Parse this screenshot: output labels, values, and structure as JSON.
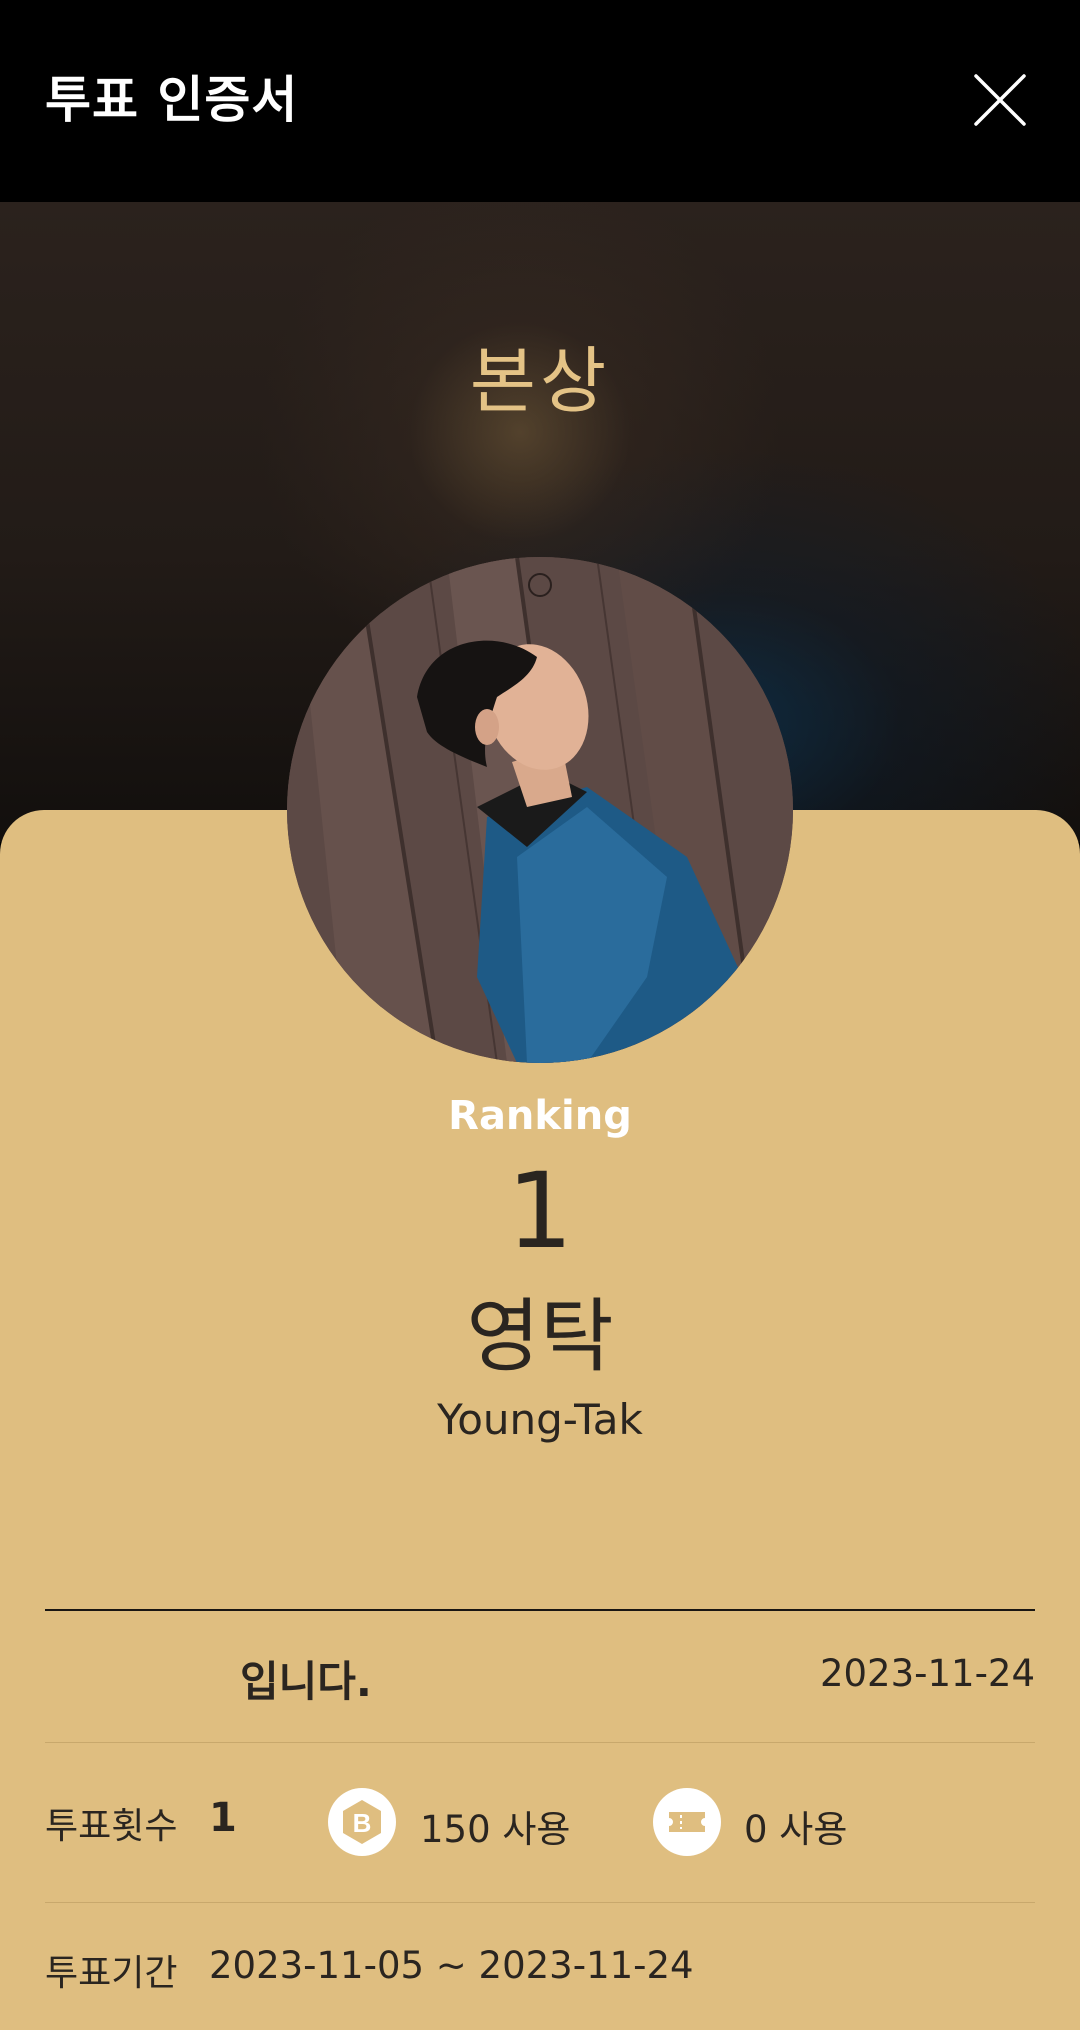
{
  "header": {
    "title": "투표 인증서"
  },
  "hero": {
    "award": "본상"
  },
  "profile": {
    "ranking_label": "Ranking",
    "ranking_value": "1",
    "name_ko": "영탁",
    "name_en": "Young-Tak"
  },
  "certificate": {
    "text": "입니다.",
    "date": "2023-11-24"
  },
  "vote_count": {
    "label": "투표횟수",
    "value": "1",
    "coin_amount": "150 사용",
    "ticket_amount": "0 사용"
  },
  "vote_period": {
    "label": "투표기간",
    "value": "2023-11-05 ~ 2023-11-24"
  },
  "colors": {
    "card_background": "#dfbe80",
    "award_text": "#e4c386",
    "header_background": "#000000"
  }
}
